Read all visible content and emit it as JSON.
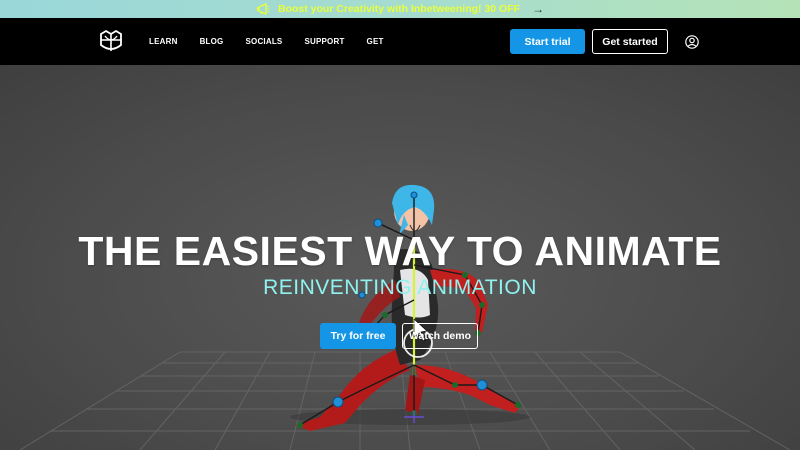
{
  "promo": {
    "text": "Boost your Creativity with Inbetweening! 30 OFF",
    "arrow": "→",
    "icon": "megaphone-icon"
  },
  "nav": {
    "logo_icon": "inbetweening-logo-icon",
    "items": [
      "LEARN",
      "BLOG",
      "SOCIALS",
      "SUPPORT",
      "GET"
    ],
    "start_trial": "Start trial",
    "get_started": "Get started",
    "user_icon": "user-icon"
  },
  "hero": {
    "title": "THE EASIEST WAY TO ANIMATE",
    "subtitle": "REINVENTING ANIMATION",
    "try_label": "Try for free",
    "demo_label": "Watch demo"
  },
  "colors": {
    "accent_blue": "#1495e6",
    "subtitle_cyan": "#8ff2ee",
    "promo_text": "#e8ff3a",
    "nav_bg": "#000000",
    "hero_bg": "#4a4a4a"
  }
}
